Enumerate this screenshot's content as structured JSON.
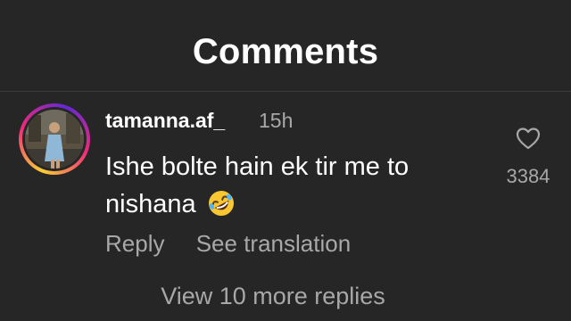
{
  "header": {
    "title": "Comments"
  },
  "comment": {
    "username": "tamanna.af_",
    "timestamp": "15h",
    "text": "Ishe bolte hain ek tir me to nishana",
    "emoji_icon": "rolling-on-floor-laughing-emoji",
    "like_count": "3384",
    "actions": {
      "reply": "Reply",
      "see_translation": "See translation"
    }
  },
  "replies": {
    "view_more_label": "View 10 more replies"
  },
  "colors": {
    "background": "#262626",
    "primary_text": "#ffffff",
    "secondary_text": "#a8a8a8"
  }
}
